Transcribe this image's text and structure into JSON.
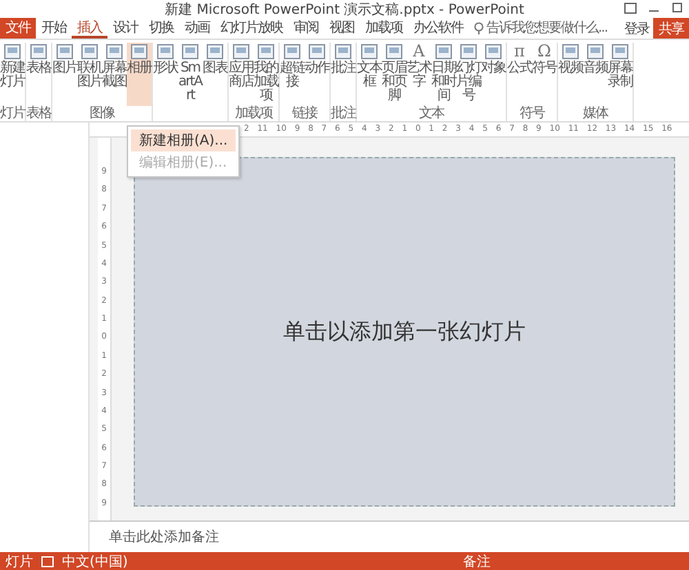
{
  "window": {
    "title": "新建 Microsoft PowerPoint 演示文稿.pptx - PowerPoint"
  },
  "tabs": [
    {
      "label": "文件",
      "kind": "file",
      "selected": false
    },
    {
      "label": "开始",
      "kind": "tab",
      "selected": false
    },
    {
      "label": "插入",
      "kind": "tab",
      "selected": true
    },
    {
      "label": "设计",
      "kind": "tab",
      "selected": false
    },
    {
      "label": "切换",
      "kind": "tab",
      "selected": false
    },
    {
      "label": "动画",
      "kind": "tab",
      "selected": false
    },
    {
      "label": "幻灯片放映",
      "kind": "tab",
      "selected": false
    },
    {
      "label": "审阅",
      "kind": "tab",
      "selected": false
    },
    {
      "label": "视图",
      "kind": "tab",
      "selected": false
    },
    {
      "label": "加载项",
      "kind": "tab",
      "selected": false
    },
    {
      "label": "办公软件",
      "kind": "tab",
      "selected": false
    }
  ],
  "tell_me": {
    "placeholder": "告诉我您想要做什么..."
  },
  "sign_in": "登录",
  "share": "共享",
  "ribbon_groups": [
    {
      "label": "灯片",
      "buttons": [
        {
          "label": "新建灯片",
          "open": false
        }
      ]
    },
    {
      "label": "表格",
      "buttons": [
        {
          "label": "表格",
          "open": false
        }
      ]
    },
    {
      "label": "图像",
      "buttons": [
        {
          "label": "图片",
          "open": false
        },
        {
          "label": "联机图片",
          "open": false
        },
        {
          "label": "屏幕截图",
          "open": false
        },
        {
          "label": "相册",
          "open": true
        }
      ]
    },
    {
      "buttons": [
        {
          "label": "形状",
          "open": false
        },
        {
          "label": "SmartArt",
          "open": false
        },
        {
          "label": "图表",
          "open": false
        }
      ]
    },
    {
      "label": "加载项",
      "buttons": [
        {
          "label": "应用商店",
          "open": false
        },
        {
          "label": "我的加载项",
          "open": false
        }
      ]
    },
    {
      "label": "链接",
      "buttons": [
        {
          "label": "超链接",
          "open": false
        },
        {
          "label": "动作",
          "open": false
        }
      ]
    },
    {
      "label": "批注",
      "buttons": [
        {
          "label": "批注",
          "open": false
        }
      ]
    },
    {
      "label": "文本",
      "buttons": [
        {
          "label": "文本框",
          "open": false
        },
        {
          "label": "页眉和页脚",
          "open": false
        },
        {
          "label": "艺术字",
          "glyph": "A",
          "open": false
        },
        {
          "label": "日期和时间",
          "open": false
        },
        {
          "label": "幻灯片编号",
          "open": false
        },
        {
          "label": "对象",
          "open": false
        }
      ]
    },
    {
      "label": "符号",
      "buttons": [
        {
          "label": "公式",
          "glyph": "π",
          "open": false
        },
        {
          "label": "符号",
          "glyph": "Ω",
          "open": false
        }
      ]
    },
    {
      "label": "媒体",
      "buttons": [
        {
          "label": "视频",
          "open": false
        },
        {
          "label": "音频",
          "open": false
        },
        {
          "label": "屏幕录制",
          "open": false
        }
      ]
    }
  ],
  "dropdown": {
    "items": [
      {
        "label": "新建相册(A)...",
        "selected": true,
        "disabled": false
      },
      {
        "label": "编辑相册(E)...",
        "selected": false,
        "disabled": true
      }
    ]
  },
  "ruler_h": [
    "2",
    "11",
    "10",
    "9",
    "8",
    "7",
    "6",
    "5",
    "4",
    "3",
    "2",
    "1",
    "0",
    "1",
    "2",
    "3",
    "4",
    "5",
    "6",
    "7",
    "8",
    "9",
    "10",
    "11",
    "12",
    "13",
    "14",
    "15",
    "16"
  ],
  "ruler_v": [
    "9",
    "8",
    "7",
    "6",
    "5",
    "4",
    "3",
    "2",
    "1",
    "0",
    "1",
    "2",
    "3",
    "4",
    "5",
    "6",
    "7",
    "8",
    "9"
  ],
  "slide": {
    "title_placeholder": "单击以添加第一张幻灯片"
  },
  "notes": {
    "placeholder": "单击此处添加备注"
  },
  "status_bar": {
    "slide": "灯片",
    "language": "中文(中国)",
    "notes": "备注"
  }
}
